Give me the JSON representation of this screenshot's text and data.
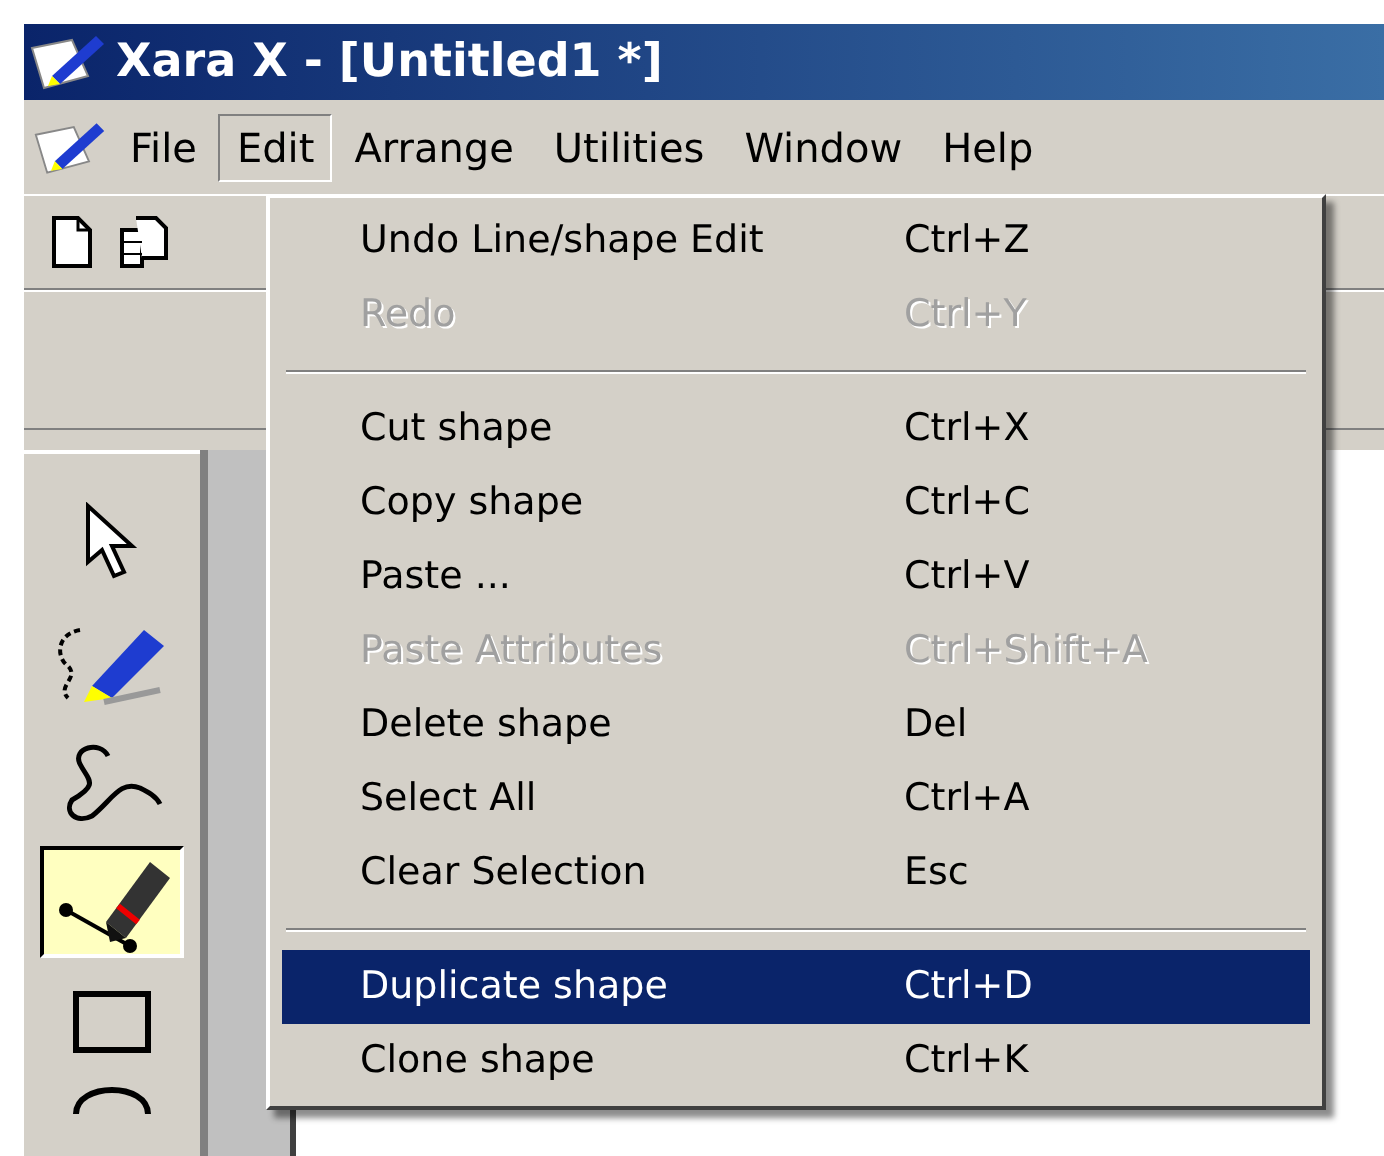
{
  "window": {
    "title": "Xara X - [Untitled1 *]"
  },
  "menu_bar": [
    {
      "label": "File",
      "selected": false
    },
    {
      "label": "Edit",
      "selected": true
    },
    {
      "label": "Arrange",
      "selected": false
    },
    {
      "label": "Utilities",
      "selected": false
    },
    {
      "label": "Window",
      "selected": false
    },
    {
      "label": "Help",
      "selected": false
    }
  ],
  "toolbox": [
    {
      "kind": "selector",
      "selected": false
    },
    {
      "kind": "freehand",
      "selected": false
    },
    {
      "kind": "bezier",
      "selected": false
    },
    {
      "kind": "shapeeditor",
      "selected": true
    },
    {
      "kind": "rectangle",
      "selected": false
    },
    {
      "kind": "ellipse",
      "selected": false
    }
  ],
  "edit_menu": [
    {
      "kind": "item",
      "label": "Undo Line/shape Edit",
      "shortcut": "Ctrl+Z",
      "disabled": false,
      "selected": false
    },
    {
      "kind": "item",
      "label": "Redo",
      "shortcut": "Ctrl+Y",
      "disabled": true,
      "selected": false
    },
    {
      "kind": "separator"
    },
    {
      "kind": "item",
      "label": "Cut shape",
      "shortcut": "Ctrl+X",
      "disabled": false,
      "selected": false
    },
    {
      "kind": "item",
      "label": "Copy shape",
      "shortcut": "Ctrl+C",
      "disabled": false,
      "selected": false
    },
    {
      "kind": "item",
      "label": "Paste ...",
      "shortcut": "Ctrl+V",
      "disabled": false,
      "selected": false
    },
    {
      "kind": "item",
      "label": "Paste Attributes",
      "shortcut": "Ctrl+Shift+A",
      "disabled": true,
      "selected": false
    },
    {
      "kind": "item",
      "label": "Delete shape",
      "shortcut": "Del",
      "disabled": false,
      "selected": false
    },
    {
      "kind": "item",
      "label": "Select All",
      "shortcut": "Ctrl+A",
      "disabled": false,
      "selected": false
    },
    {
      "kind": "item",
      "label": "Clear Selection",
      "shortcut": "Esc",
      "disabled": false,
      "selected": false
    },
    {
      "kind": "separator"
    },
    {
      "kind": "item",
      "label": "Duplicate shape",
      "shortcut": "Ctrl+D",
      "disabled": false,
      "selected": true
    },
    {
      "kind": "item",
      "label": "Clone shape",
      "shortcut": "Ctrl+K",
      "disabled": false,
      "selected": false
    }
  ]
}
